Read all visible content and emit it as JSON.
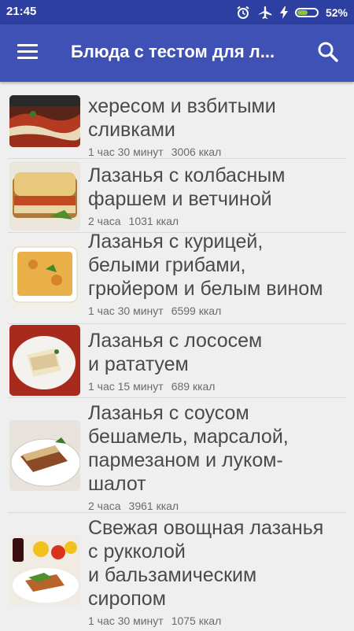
{
  "status_bar": {
    "time": "21:45",
    "battery_percent": "52%",
    "battery_level": 0.52,
    "icons": [
      "alarm-clock-icon",
      "airplane-mode-icon",
      "charging-icon",
      "battery-icon"
    ]
  },
  "app_bar": {
    "title": "Блюда с тестом для л...",
    "menu_icon": "hamburger-menu-icon",
    "search_icon": "search-icon"
  },
  "recipes": [
    {
      "lines": [
        "хересом и взбитыми",
        "сливками"
      ],
      "time": "1 час 30 минут",
      "kcal": "3006 ккал"
    },
    {
      "lines": [
        "Лазанья с колбасным",
        "фаршем и ветчиной"
      ],
      "time": "2 часа",
      "kcal": "1031 ккал"
    },
    {
      "lines": [
        "Лазанья с курицей,",
        "белыми грибами,",
        "грюйером и белым вином"
      ],
      "time": "1 час 30 минут",
      "kcal": "6599 ккал"
    },
    {
      "lines": [
        "Лазанья с лососем",
        "и рататуем"
      ],
      "time": "1 час 15 минут",
      "kcal": "689 ккал"
    },
    {
      "lines": [
        "Лазанья с соусом",
        "бешамель, марсалой,",
        "пармезаном и луком-",
        "шалот"
      ],
      "time": "2 часа",
      "kcal": "3961 ккал"
    },
    {
      "lines": [
        "Свежая овощная лазанья",
        "с рукколой",
        "и бальзамическим",
        "сиропом"
      ],
      "time": "1 час 30 минут",
      "kcal": "1075 ккал"
    }
  ]
}
